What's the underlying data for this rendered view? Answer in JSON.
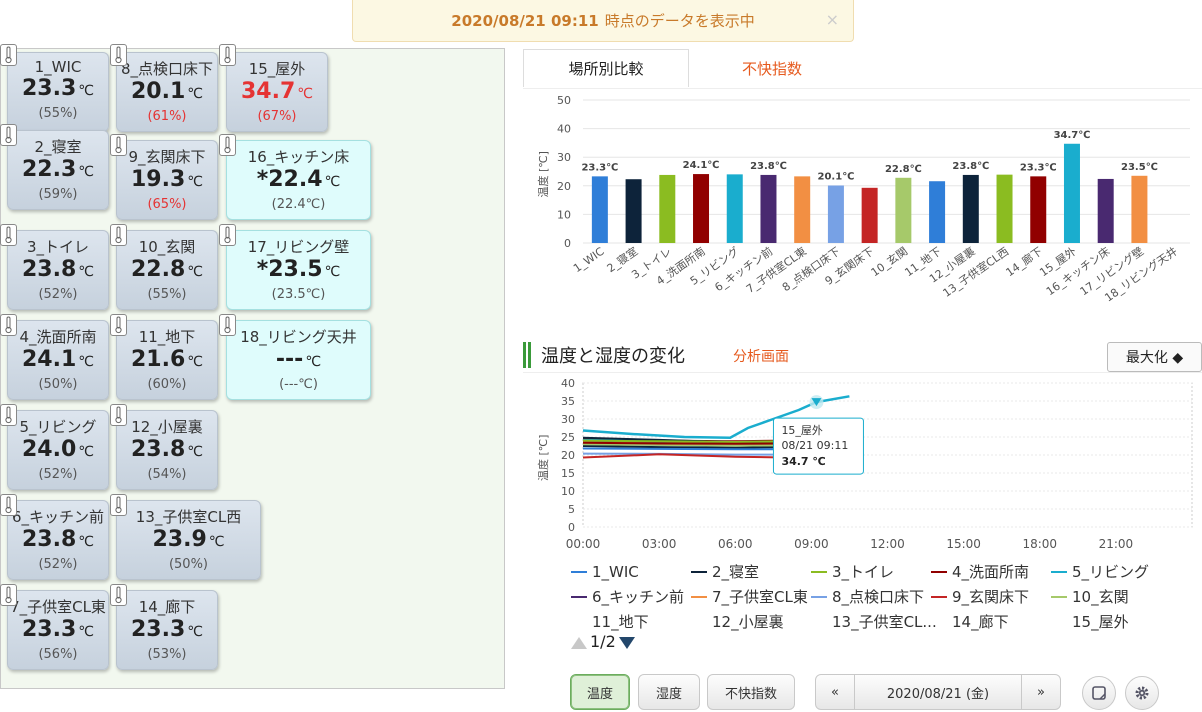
{
  "banner": {
    "datetime": "2020/08/21 09:11",
    "message": "時点のデータを表示中",
    "close": "×"
  },
  "sensors": [
    {
      "name": "1_WIC",
      "temp": "23.3",
      "unit": "℃",
      "hum": "(55%)",
      "style": "normal"
    },
    {
      "name": "8_点検口床下",
      "temp": "20.1",
      "unit": "℃",
      "hum": "(61%)",
      "style": "normal",
      "hum_red": true
    },
    {
      "name": "15_屋外",
      "temp": "34.7",
      "unit": "℃",
      "hum": "(67%)",
      "style": "normal",
      "temp_red": true,
      "hum_red": true
    },
    {
      "name": "2_寝室",
      "temp": "22.3",
      "unit": "℃",
      "hum": "(59%)",
      "style": "normal"
    },
    {
      "name": "9_玄関床下",
      "temp": "19.3",
      "unit": "℃",
      "hum": "(65%)",
      "style": "normal",
      "hum_red": true
    },
    {
      "name": "16_キッチン床",
      "temp": "*22.4",
      "unit": "℃",
      "hum": "(22.4℃)",
      "style": "cyan"
    },
    {
      "name": "3_トイレ",
      "temp": "23.8",
      "unit": "℃",
      "hum": "(52%)",
      "style": "normal"
    },
    {
      "name": "10_玄関",
      "temp": "22.8",
      "unit": "℃",
      "hum": "(55%)",
      "style": "normal"
    },
    {
      "name": "17_リビング壁",
      "temp": "*23.5",
      "unit": "℃",
      "hum": "(23.5℃)",
      "style": "cyan"
    },
    {
      "name": "4_洗面所南",
      "temp": "24.1",
      "unit": "℃",
      "hum": "(50%)",
      "style": "normal"
    },
    {
      "name": "11_地下",
      "temp": "21.6",
      "unit": "℃",
      "hum": "(60%)",
      "style": "normal"
    },
    {
      "name": "18_リビング天井",
      "temp": "---",
      "unit": "℃",
      "hum": "(---℃)",
      "style": "cyan"
    },
    {
      "name": "5_リビング",
      "temp": "24.0",
      "unit": "℃",
      "hum": "(52%)",
      "style": "normal"
    },
    {
      "name": "12_小屋裏",
      "temp": "23.8",
      "unit": "℃",
      "hum": "(54%)",
      "style": "normal"
    },
    {
      "name": "6_キッチン前",
      "temp": "23.8",
      "unit": "℃",
      "hum": "(52%)",
      "style": "normal"
    },
    {
      "name": "13_子供室CL西",
      "temp": "23.9",
      "unit": "℃",
      "hum": "(50%)",
      "style": "normal"
    },
    {
      "name": "7_子供室CL東",
      "temp": "23.3",
      "unit": "℃",
      "hum": "(56%)",
      "style": "normal"
    },
    {
      "name": "14_廊下",
      "temp": "23.3",
      "unit": "℃",
      "hum": "(53%)",
      "style": "normal"
    }
  ],
  "tabs": [
    {
      "label": "場所別比較",
      "active": true
    },
    {
      "label": "不快指数",
      "active": false
    }
  ],
  "section2": {
    "title": "温度と湿度の変化",
    "link": "分析画面",
    "maximize": "最大化 ◆"
  },
  "tooltip": {
    "name": "15_屋外",
    "time": "08/21 09:11",
    "value": "34.7 ℃"
  },
  "pager": {
    "text": "1/2"
  },
  "bottom": {
    "btn_temp": "温度",
    "btn_hum": "湿度",
    "btn_discomfort": "不快指数",
    "prev": "«",
    "date": "2020/08/21 (金)",
    "next": "»"
  },
  "chart_data": [
    {
      "type": "bar",
      "ylabel": "温度 [℃]",
      "ylim": [
        0,
        50
      ],
      "yticks": [
        0,
        10,
        20,
        30,
        40,
        50
      ],
      "categories": [
        "1_WIC",
        "2_寝室",
        "3_トイレ",
        "4_洗面所南",
        "5_リビング",
        "6_キッチン前",
        "7_子供室CL東",
        "8_点検口床下",
        "9_玄関床下",
        "10_玄関",
        "11_地下",
        "12_小屋裏",
        "13_子供室CL西",
        "14_廊下",
        "15_屋外",
        "16_キッチン床",
        "17_リビング壁",
        "18_リビング天井"
      ],
      "values": [
        23.3,
        22.3,
        23.8,
        24.1,
        24.0,
        23.8,
        23.3,
        20.1,
        19.3,
        22.8,
        21.6,
        23.8,
        23.9,
        23.3,
        34.7,
        22.4,
        23.5,
        null
      ],
      "colors": [
        "#2f7ed8",
        "#0d233a",
        "#8bbc21",
        "#910000",
        "#1aadce",
        "#492970",
        "#f28f43",
        "#77a1e5",
        "#c42525",
        "#a6c96a",
        "#2f7ed8",
        "#0d233a",
        "#8bbc21",
        "#910000",
        "#1aadce",
        "#492970",
        "#f28f43",
        "#77a1e5"
      ],
      "data_labels": [
        "23.3℃",
        "",
        "",
        "24.1℃",
        "",
        "23.8℃",
        "",
        "20.1℃",
        "",
        "22.8℃",
        "",
        "23.8℃",
        "",
        "23.3℃",
        "34.7℃",
        "",
        "23.5℃",
        ""
      ]
    },
    {
      "type": "line",
      "ylabel": "温度 [℃]",
      "ylim": [
        0,
        40
      ],
      "yticks": [
        0,
        5,
        10,
        15,
        20,
        25,
        30,
        35,
        40
      ],
      "xticks": [
        "00:00",
        "03:00",
        "06:00",
        "09:00",
        "12:00",
        "15:00",
        "18:00",
        "21:00"
      ],
      "xlim_hours": [
        0,
        24
      ],
      "series": [
        {
          "name": "1_WIC",
          "color": "#2f7ed8",
          "points": [
            [
              0,
              23.0
            ],
            [
              3,
              22.8
            ],
            [
              6,
              22.6
            ],
            [
              8,
              23.0
            ],
            [
              9.2,
              23.3
            ]
          ]
        },
        {
          "name": "2_寝室",
          "color": "#0d233a",
          "points": [
            [
              0,
              22.5
            ],
            [
              3,
              22.2
            ],
            [
              6,
              22.0
            ],
            [
              8,
              22.2
            ],
            [
              9.2,
              22.3
            ]
          ]
        },
        {
          "name": "3_トイレ",
          "color": "#8bbc21",
          "points": [
            [
              0,
              23.6
            ],
            [
              3,
              23.4
            ],
            [
              6,
              23.3
            ],
            [
              8,
              23.6
            ],
            [
              9.2,
              23.8
            ]
          ]
        },
        {
          "name": "4_洗面所南",
          "color": "#910000",
          "points": [
            [
              0,
              24.5
            ],
            [
              3,
              24.0
            ],
            [
              6,
              23.8
            ],
            [
              8,
              24.0
            ],
            [
              9.2,
              24.1
            ]
          ]
        },
        {
          "name": "5_リビング",
          "color": "#1aadce",
          "points": [
            [
              0,
              24.2
            ],
            [
              3,
              24.0
            ],
            [
              6,
              23.6
            ],
            [
              8,
              23.8
            ],
            [
              9.2,
              24.0
            ]
          ]
        },
        {
          "name": "6_キッチン前",
          "color": "#492970",
          "points": [
            [
              0,
              24.0
            ],
            [
              3,
              23.7
            ],
            [
              6,
              23.4
            ],
            [
              8,
              23.6
            ],
            [
              9.2,
              23.8
            ]
          ]
        },
        {
          "name": "7_子供室CL東",
          "color": "#f28f43",
          "points": [
            [
              0,
              23.4
            ],
            [
              3,
              23.2
            ],
            [
              6,
              23.0
            ],
            [
              8,
              23.2
            ],
            [
              9.2,
              23.3
            ]
          ]
        },
        {
          "name": "8_点検口床下",
          "color": "#77a1e5",
          "points": [
            [
              0,
              20.4
            ],
            [
              3,
              20.3
            ],
            [
              6,
              20.1
            ],
            [
              8,
              20.1
            ],
            [
              9.2,
              20.1
            ]
          ]
        },
        {
          "name": "9_玄関床下",
          "color": "#c42525",
          "points": [
            [
              0,
              19.3
            ],
            [
              3,
              20.2
            ],
            [
              6,
              19.5
            ],
            [
              8,
              19.3
            ],
            [
              9.2,
              19.3
            ]
          ]
        },
        {
          "name": "10_玄関",
          "color": "#a6c96a",
          "points": [
            [
              0,
              23.0
            ],
            [
              3,
              22.8
            ],
            [
              6,
              22.6
            ],
            [
              8,
              22.7
            ],
            [
              9.2,
              22.8
            ]
          ]
        },
        {
          "name": "11_地下",
          "color": "#2f7ed8",
          "points": [
            [
              0,
              21.8
            ],
            [
              3,
              21.7
            ],
            [
              6,
              21.6
            ],
            [
              8,
              21.6
            ],
            [
              9.2,
              21.6
            ]
          ]
        },
        {
          "name": "12_小屋裏",
          "color": "#0d233a",
          "points": [
            [
              0,
              24.8
            ],
            [
              3,
              24.2
            ],
            [
              6,
              23.5
            ],
            [
              8,
              23.6
            ],
            [
              9.2,
              23.8
            ]
          ]
        },
        {
          "name": "13_子供室CL西",
          "color": "#8bbc21",
          "points": [
            [
              0,
              24.0
            ],
            [
              3,
              23.8
            ],
            [
              6,
              23.6
            ],
            [
              8,
              23.8
            ],
            [
              9.2,
              23.9
            ]
          ]
        },
        {
          "name": "14_廊下",
          "color": "#910000",
          "points": [
            [
              0,
              23.4
            ],
            [
              3,
              23.2
            ],
            [
              6,
              23.1
            ],
            [
              8,
              23.2
            ],
            [
              9.2,
              23.3
            ]
          ]
        },
        {
          "name": "15_屋外",
          "color": "#1aadce",
          "points": [
            [
              0,
              26.8
            ],
            [
              2,
              25.8
            ],
            [
              4,
              25.0
            ],
            [
              5.8,
              24.8
            ],
            [
              6.5,
              27.5
            ],
            [
              7.5,
              30.0
            ],
            [
              8.5,
              32.5
            ],
            [
              9.2,
              34.7
            ],
            [
              10.5,
              36.3
            ]
          ]
        }
      ],
      "legend_page1": [
        "1_WIC",
        "2_寝室",
        "3_トイレ",
        "4_洗面所南",
        "5_リビング",
        "6_キッチン前",
        "7_子供室CL東",
        "8_点検口床下",
        "9_玄関床下",
        "10_玄関"
      ],
      "legend_page1_colors": [
        "#2f7ed8",
        "#0d233a",
        "#8bbc21",
        "#910000",
        "#1aadce",
        "#492970",
        "#f28f43",
        "#77a1e5",
        "#c42525",
        "#a6c96a"
      ],
      "legend_cut": [
        "11_地下",
        "12_小屋裏",
        "13_子供室CL...",
        "14_廊下",
        "15_屋外"
      ]
    }
  ]
}
